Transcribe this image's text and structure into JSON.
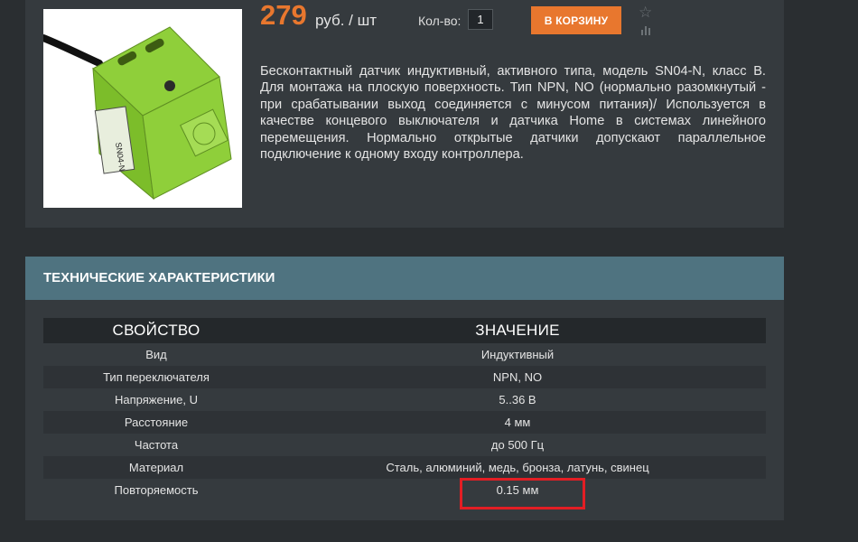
{
  "product": {
    "price_value": "279",
    "price_unit": "руб. / шт",
    "qty_label": "Кол-во:",
    "qty_value": "1",
    "cart_button_label": "В КОРЗИНУ",
    "image_label": "SN04-N",
    "description": "Бесконтактный датчик индуктивный, активного типа, модель SN04-N, класс B. Для монтажа на плоскую поверхность. Тип NPN, NO (нормально разомкнутый - при срабатывании выход соединяется с минусом питания)/ Используется в качестве концевого выключателя и датчика Home в системах линейного перемещения. Нормально открытые датчики допускают параллельное подключение к одному входу контроллера."
  },
  "icons": {
    "favorite": "star-icon",
    "compare": "bar-chart-icon"
  },
  "specs": {
    "title": "ТЕХНИЧЕСКИЕ ХАРАКТЕРИСТИКИ",
    "col_property": "Свойство",
    "col_value": "Значение",
    "rows": [
      {
        "property": "Вид",
        "value": "Индуктивный"
      },
      {
        "property": "Тип переключателя",
        "value": "NPN, NO"
      },
      {
        "property": "Напряжение, U",
        "value": "5..36 В"
      },
      {
        "property": "Расстояние",
        "value": "4 мм"
      },
      {
        "property": "Частота",
        "value": "до 500 Гц"
      },
      {
        "property": "Материал",
        "value": "Сталь, алюминий, медь, бронза, латунь, свинец"
      },
      {
        "property": "Повторяемость",
        "value": "0.15 мм"
      }
    ]
  },
  "colors": {
    "accent": "#e8772e",
    "header_bar": "#4f7380",
    "highlight": "#e31e24",
    "panel": "#353a3e",
    "background": "#2a2e31"
  }
}
